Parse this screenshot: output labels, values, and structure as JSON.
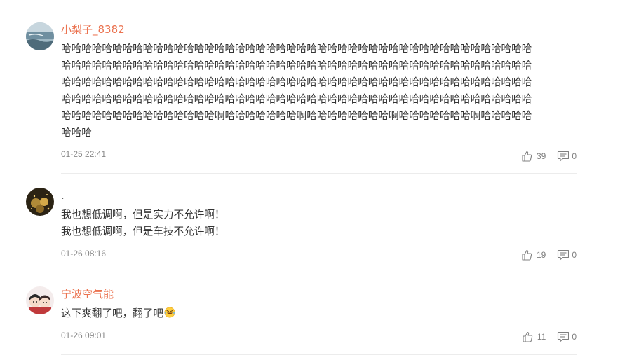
{
  "comments": [
    {
      "username": "小梨子_8382",
      "text_lines": [
        "哈哈哈哈哈哈哈哈哈哈哈哈哈哈哈哈哈哈哈哈哈哈哈哈哈哈哈哈哈哈哈哈哈哈哈哈哈哈哈哈哈哈哈哈哈哈",
        "哈哈哈哈哈哈哈哈哈哈哈哈哈哈哈哈哈哈哈哈哈哈哈哈哈哈哈哈哈哈哈哈哈哈哈哈哈哈哈哈哈哈哈哈哈哈",
        "哈哈哈哈哈哈哈哈哈哈哈哈哈哈哈哈哈哈哈哈哈哈哈哈哈哈哈哈哈哈哈哈哈哈哈哈哈哈哈哈哈哈哈哈哈哈",
        "哈哈哈哈哈哈哈哈哈哈哈哈哈哈哈哈哈哈哈哈哈哈哈哈哈哈哈哈哈哈哈哈哈哈哈哈哈哈哈哈哈哈哈哈哈哈",
        "哈哈哈哈哈哈哈哈哈哈哈哈哈哈哈啊哈哈哈哈哈哈哈啊哈哈哈哈哈哈哈哈啊哈哈哈哈哈哈哈啊哈哈哈哈哈",
        "哈哈哈"
      ],
      "timestamp": "01-25 22:41",
      "likes": "39",
      "replies": "0"
    },
    {
      "username": ".",
      "text_lines": [
        "我也想低调啊，但是实力不允许啊！",
        "我也想低调啊，但是车技不允许啊！"
      ],
      "timestamp": "01-26 08:16",
      "likes": "19",
      "replies": "0"
    },
    {
      "username": "宁波空气能",
      "text_lines": [
        "这下爽翻了吧，翻了吧"
      ],
      "emoji": "laughing-tears-emoji",
      "timestamp": "01-26 09:01",
      "likes": "11",
      "replies": "0"
    }
  ],
  "colors": {
    "username": "#eb7350",
    "text": "#333333",
    "meta": "#888888",
    "divider": "#ececec"
  },
  "icons": {
    "like": "thumbs-up-icon",
    "reply": "comment-bubble-icon"
  }
}
